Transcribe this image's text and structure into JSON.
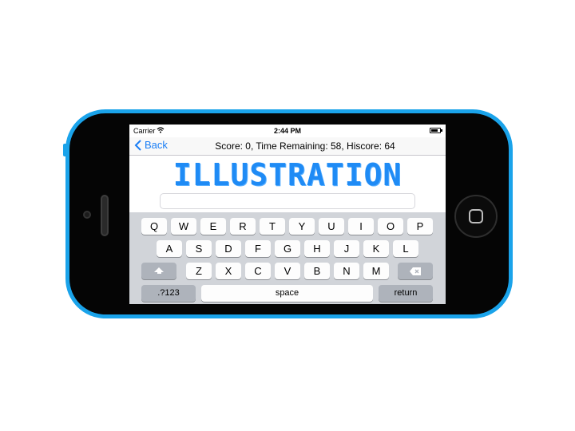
{
  "status_bar": {
    "carrier": "Carrier",
    "time": "2:44 PM"
  },
  "nav": {
    "back_label": "Back",
    "score_text": "Score: 0, Time Remaining: 58, Hiscore: 64"
  },
  "game": {
    "word": "ILLUSTRATION",
    "answer_value": ""
  },
  "keyboard": {
    "row1": [
      "Q",
      "W",
      "E",
      "R",
      "T",
      "Y",
      "U",
      "I",
      "O",
      "P"
    ],
    "row2": [
      "A",
      "S",
      "D",
      "F",
      "G",
      "H",
      "J",
      "K",
      "L"
    ],
    "row3": [
      "Z",
      "X",
      "C",
      "V",
      "B",
      "N",
      "M"
    ],
    "numbers_label": ".?123",
    "space_label": "space",
    "return_label": "return"
  },
  "colors": {
    "phone_shell": "#1aa3ea",
    "accent": "#1a7ef5",
    "word": "#1f8bf5"
  },
  "icons": [
    "wifi-icon",
    "battery-icon",
    "back-chevron-icon",
    "shift-icon",
    "backspace-icon",
    "home-button-icon"
  ]
}
